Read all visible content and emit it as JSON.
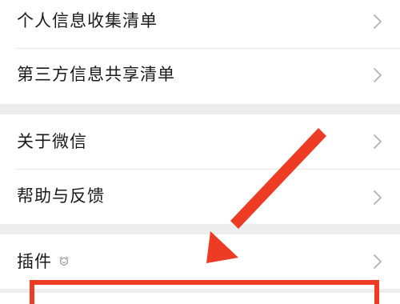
{
  "settings_list": {
    "groups": [
      {
        "items": [
          {
            "label": "个人信息收集清单"
          },
          {
            "label": "第三方信息共享清单"
          }
        ]
      },
      {
        "items": [
          {
            "label": "关于微信"
          },
          {
            "label": "帮助与反馈"
          }
        ]
      },
      {
        "items": [
          {
            "label": "插件"
          }
        ]
      }
    ]
  },
  "icons": {
    "chevron": "chevron-right-icon",
    "plugin_badge": "plugin-badge-icon"
  },
  "annotation": {
    "color": "#ee3b24"
  }
}
